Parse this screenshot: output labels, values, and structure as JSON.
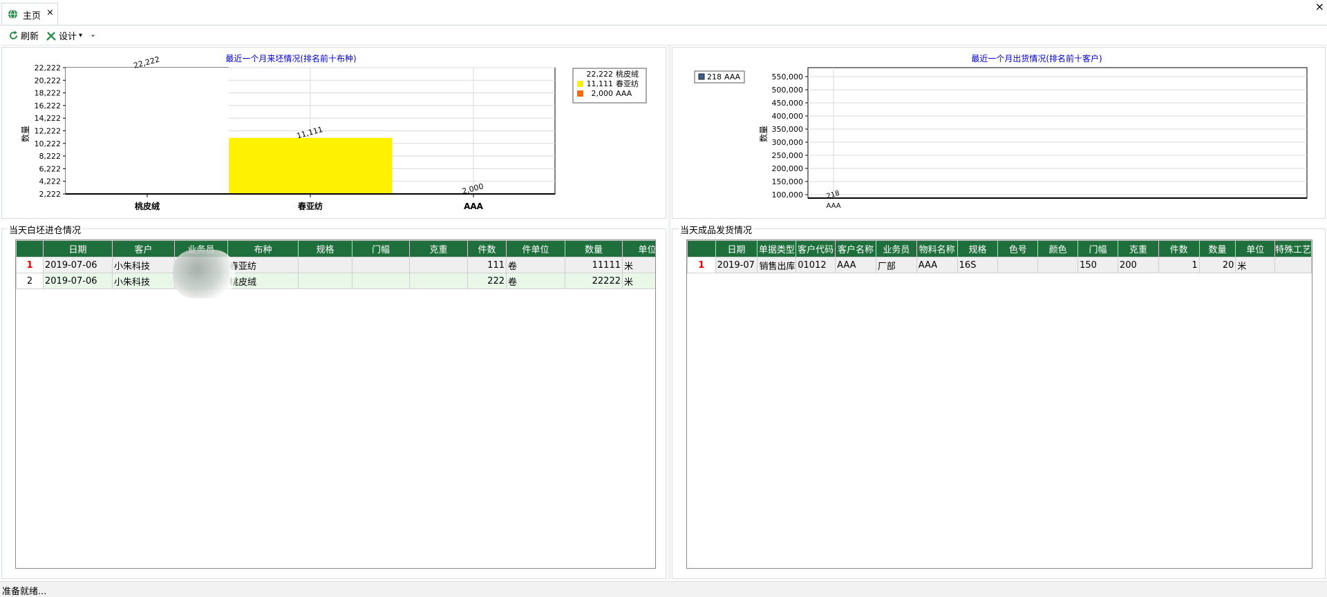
{
  "tab": {
    "title": "主页",
    "close": "×"
  },
  "window": {
    "close": "×"
  },
  "toolbar": {
    "refresh": "刷新",
    "design": "设计",
    "design_arrow": "▾",
    "more": "⌄"
  },
  "chart_left": {
    "title": "最近一个月来坯情况(排名前十布种)",
    "ylabel": "数量",
    "yticks": [
      "22,222",
      "20,222",
      "18,222",
      "16,222",
      "14,222",
      "12,222",
      "10,222",
      "8,222",
      "6,222",
      "4,222",
      "2,222"
    ],
    "legend": [
      {
        "value": "22,222",
        "name": "桃皮绒"
      },
      {
        "value": "11,111",
        "name": "春亚纺"
      },
      {
        "value": "2,000",
        "name": "AAA"
      }
    ]
  },
  "chart_right": {
    "title": "最近一个月出货情况(排名前十客户)",
    "ylabel": "数量",
    "yticks": [
      "550,000",
      "500,000",
      "450,000",
      "400,000",
      "350,000",
      "300,000",
      "250,000",
      "200,000",
      "150,000",
      "100,000"
    ],
    "legend": [
      {
        "value": "218",
        "name": "AAA"
      }
    ]
  },
  "chart_data": [
    {
      "type": "bar",
      "title": "最近一个月来坯情况(排名前十布种)",
      "ylabel": "数量",
      "xlabel": "",
      "categories": [
        "桃皮绒",
        "春亚纺",
        "AAA"
      ],
      "values": [
        22222,
        11111,
        2000
      ],
      "value_labels": [
        "22,222",
        "11,111",
        "2,000"
      ],
      "ylim": [
        2222,
        22222
      ],
      "colors": [
        "#ffffff",
        "#fff200",
        "#ff6a00"
      ],
      "grid": true,
      "legend": "top-right"
    },
    {
      "type": "bar",
      "title": "最近一个月出货情况(排名前十客户)",
      "ylabel": "数量",
      "xlabel": "",
      "categories": [
        "AAA"
      ],
      "values": [
        218
      ],
      "value_labels": [
        "218"
      ],
      "ylim": [
        100000,
        550000
      ],
      "colors": [
        "#3a5f8f"
      ],
      "grid": true,
      "legend": "top-left"
    }
  ],
  "grid_left": {
    "title": "当天白坯进仓情况",
    "columns": [
      "日期",
      "客户",
      "业务员",
      "布种",
      "规格",
      "门幅",
      "克重",
      "件数",
      "件单位",
      "数量",
      "单位"
    ],
    "rows": [
      {
        "no": "1",
        "cells": [
          "2019-07-06",
          "小朱科技",
          "",
          "春亚纺",
          "",
          "",
          "",
          "111",
          "卷",
          "11111",
          "米"
        ]
      },
      {
        "no": "2",
        "cells": [
          "2019-07-06",
          "小朱科技",
          "",
          "桃皮绒",
          "",
          "",
          "",
          "222",
          "卷",
          "22222",
          "米"
        ]
      }
    ]
  },
  "grid_right": {
    "title": "当天成品发货情况",
    "columns": [
      "日期",
      "单据类型",
      "客户代码",
      "客户名称",
      "业务员",
      "物料名称",
      "规格",
      "色号",
      "颜色",
      "门幅",
      "克重",
      "件数",
      "数量",
      "单位",
      "特殊工艺"
    ],
    "rows": [
      {
        "no": "1",
        "cells": [
          "2019-07",
          "销售出库",
          "01012",
          "AAA",
          "厂部",
          "AAA",
          "16S",
          "",
          "",
          "150",
          "200",
          "1",
          "20",
          "米",
          ""
        ]
      }
    ]
  },
  "status": {
    "text": "准备就绪..."
  },
  "colors": {
    "header": "#1f6f3c",
    "title_blue": "#0000cc",
    "bar_yellow": "#fff200",
    "bar_orange": "#ff6a00"
  }
}
